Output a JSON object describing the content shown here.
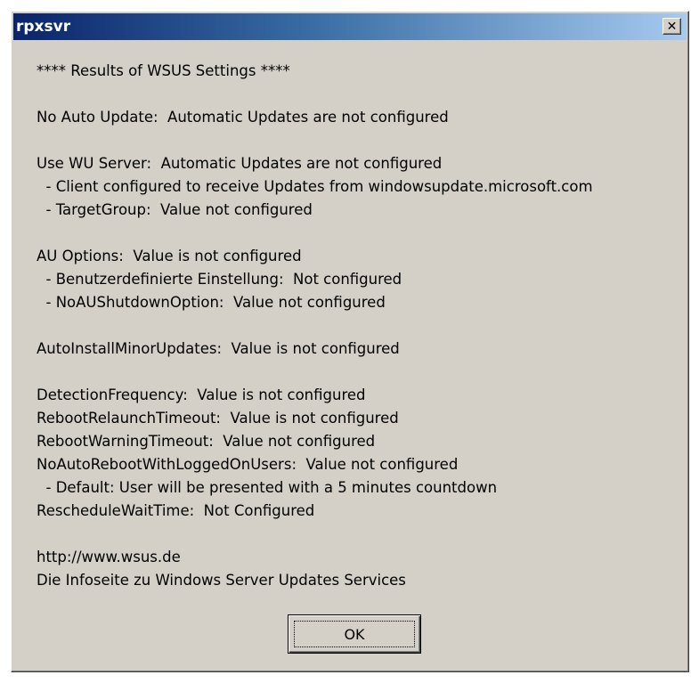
{
  "window": {
    "title": "rpxsvr",
    "close_glyph": "✕"
  },
  "message": {
    "groups": [
      [
        "**** Results of WSUS Settings ****"
      ],
      [
        "No Auto Update:  Automatic Updates are not configured"
      ],
      [
        "Use WU Server:  Automatic Updates are not configured",
        "  - Client configured to receive Updates from windowsupdate.microsoft.com",
        "  - TargetGroup:  Value not configured"
      ],
      [
        "AU Options:  Value is not configured",
        "  - Benutzerdefinierte Einstellung:  Not configured",
        "  - NoAUShutdownOption:  Value not configured"
      ],
      [
        "AutoInstallMinorUpdates:  Value is not configured"
      ],
      [
        "DetectionFrequency:  Value is not configured",
        "RebootRelaunchTimeout:  Value is not configured",
        "RebootWarningTimeout:  Value not configured",
        "NoAutoRebootWithLoggedOnUsers:  Value not configured",
        "  - Default: User will be presented with a 5 minutes countdown",
        "RescheduleWaitTime:  Not Configured"
      ],
      [
        "http://www.wsus.de",
        "Die Infoseite zu Windows Server Updates Services"
      ]
    ]
  },
  "buttons": {
    "ok_label": "OK"
  },
  "colors": {
    "dialog_bg": "#d4d0c8",
    "titlebar_start": "#0a246a",
    "titlebar_end": "#a6caf0"
  }
}
